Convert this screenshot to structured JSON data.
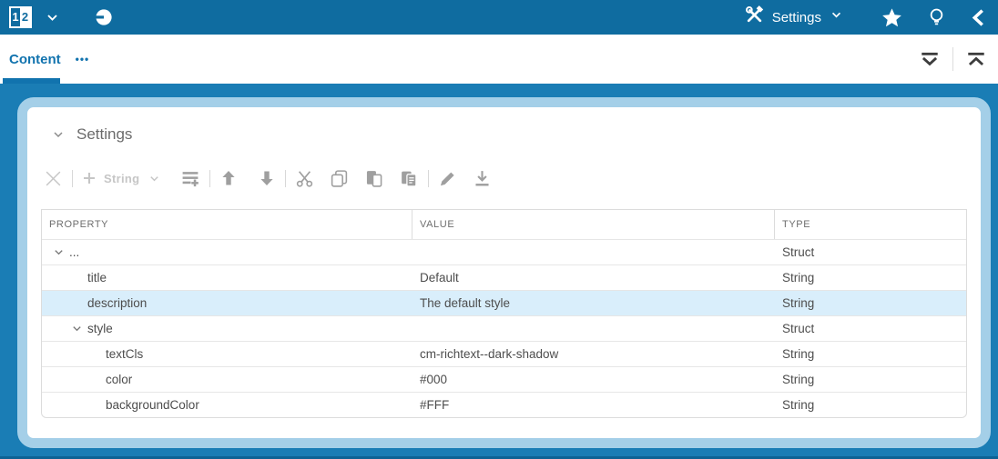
{
  "topbar": {
    "logo_left": "1",
    "logo_right": "2",
    "settings_menu_label": "Settings"
  },
  "tabbar": {
    "tabs": [
      {
        "label": "Content",
        "active": true
      }
    ],
    "overflow_label": "•••"
  },
  "section": {
    "title": "Settings"
  },
  "toolbar": {
    "add_type_label": "String"
  },
  "grid": {
    "columns": [
      {
        "label": "PROPERTY"
      },
      {
        "label": "VALUE"
      },
      {
        "label": "TYPE"
      }
    ],
    "rows": [
      {
        "property": "...",
        "value": "",
        "type": "Struct",
        "indent": 0,
        "expandable": true,
        "selected": false
      },
      {
        "property": "title",
        "value": "Default",
        "type": "String",
        "indent": 1,
        "expandable": false,
        "selected": false
      },
      {
        "property": "description",
        "value": "The default style",
        "type": "String",
        "indent": 1,
        "expandable": false,
        "selected": true
      },
      {
        "property": "style",
        "value": "",
        "type": "Struct",
        "indent": 1,
        "expandable": true,
        "selected": false
      },
      {
        "property": "textCls",
        "value": "cm-richtext--dark-shadow",
        "type": "String",
        "indent": 2,
        "expandable": false,
        "selected": false
      },
      {
        "property": "color",
        "value": "#000",
        "type": "String",
        "indent": 2,
        "expandable": false,
        "selected": false
      },
      {
        "property": "backgroundColor",
        "value": "#FFF",
        "type": "String",
        "indent": 2,
        "expandable": false,
        "selected": false
      }
    ]
  },
  "colors": {
    "topbar_bg": "#0f6ca0",
    "stage_bg": "#1a7db5",
    "panel_border": "#a4cfe8",
    "accent_blue": "#1173ae",
    "selected_row_bg": "#d9eefb"
  }
}
